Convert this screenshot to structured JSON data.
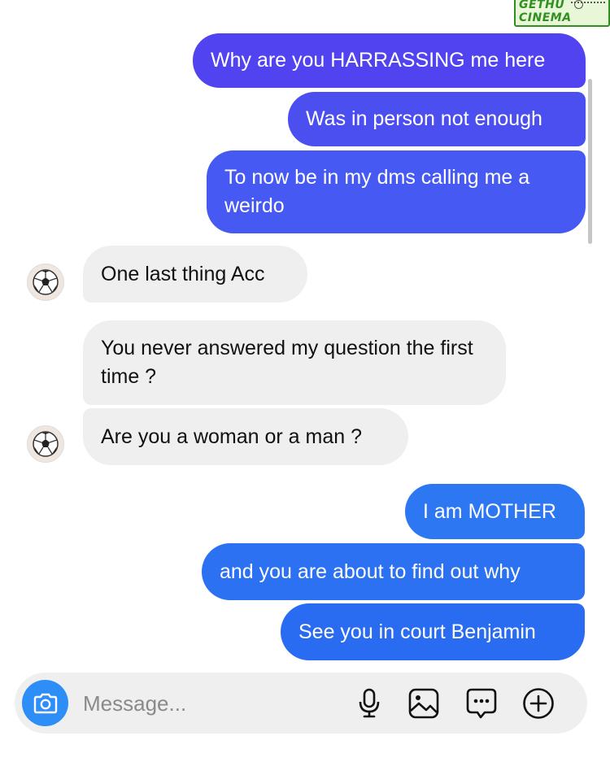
{
  "watermark": {
    "text": "GETHU CINEMA"
  },
  "messages": [
    {
      "text": "Why are you HARRASSING me here",
      "side": "outgoing"
    },
    {
      "text": "Was in person not enough",
      "side": "outgoing"
    },
    {
      "text": "To now be in my dms calling me a weirdo",
      "side": "outgoing"
    },
    {
      "text": "One last thing Acc",
      "side": "incoming"
    },
    {
      "text": "You never answered my question the first time ?",
      "side": "incoming"
    },
    {
      "text": "Are you a woman or a man ?",
      "side": "incoming"
    },
    {
      "text": "I am MOTHER",
      "side": "outgoing"
    },
    {
      "text": "and you are about to find out why",
      "side": "outgoing"
    },
    {
      "text": "See you in court Benjamin",
      "side": "outgoing"
    }
  ],
  "avatar": {
    "icon": "soccer-ball-icon"
  },
  "composer": {
    "placeholder": "Message...",
    "icons": [
      "camera-icon",
      "microphone-icon",
      "gallery-icon",
      "sticker-chat-icon",
      "plus-circle-icon"
    ]
  },
  "colors": {
    "outgoing_top": "#5143f0",
    "outgoing_bottom": "#2a6cf1",
    "incoming": "#efefef",
    "camera_button": "#2e8ef7",
    "composer_bg": "#efefef"
  }
}
